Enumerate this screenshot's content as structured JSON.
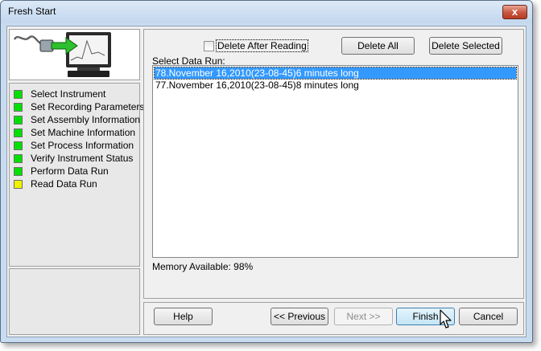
{
  "window": {
    "title": "Fresh Start",
    "close_label": "x"
  },
  "steps": [
    {
      "label": "Select Instrument",
      "status_color": "#00e000"
    },
    {
      "label": "Set Recording Parameters",
      "status_color": "#00e000"
    },
    {
      "label": "Set Assembly Information",
      "status_color": "#00e000"
    },
    {
      "label": "Set Machine Information",
      "status_color": "#00e000"
    },
    {
      "label": "Set Process Information",
      "status_color": "#00e000"
    },
    {
      "label": "Verify Instrument Status",
      "status_color": "#00e000"
    },
    {
      "label": "Perform Data Run",
      "status_color": "#00e000"
    },
    {
      "label": "Read Data Run",
      "status_color": "#f2f200"
    }
  ],
  "main": {
    "delete_after_reading_label": "Delete After Reading",
    "delete_after_reading_checked": false,
    "delete_all_label": "Delete All",
    "delete_selected_label": "Delete Selected",
    "select_label": "Select Data Run:",
    "data_runs": [
      {
        "label": "78.November 16,2010(23-08-45)6 minutes long",
        "selected": true
      },
      {
        "label": "77.November 16,2010(23-08-45)8 minutes long",
        "selected": false
      }
    ],
    "memory_label": "Memory Available: 98%"
  },
  "footer": {
    "help_label": "Help",
    "previous_label": "<< Previous",
    "next_label": "Next >>",
    "finish_label": "Finish",
    "cancel_label": "Cancel"
  },
  "colors": {
    "selection": "#3399ff",
    "title_bar": "#c9dcef"
  }
}
